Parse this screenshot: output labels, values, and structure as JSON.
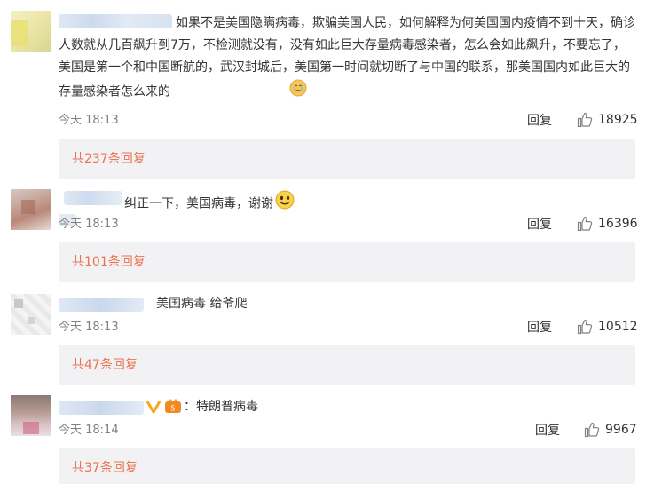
{
  "comments": [
    {
      "text": "如果不是美国隐瞒病毒，欺骗美国人民，如何解释为何美国国内疫情不到十天，确诊人数就从几百飙升到7万，不检测就没有，没有如此巨大存量病毒感染者，怎么会如此飙升，不要忘了，美国是第一个和中国断航的，武汉封城后，美国第一时间就切断了与中国的联系，那美国国内如此巨大的存量感染者怎么来的",
      "time": "今天 18:13",
      "reply": "回复",
      "likes": "18925",
      "sub_replies": "共237条回复"
    },
    {
      "text": "纠正一下，美国病毒，谢谢",
      "time": "今天 18:13",
      "reply": "回复",
      "likes": "16396",
      "sub_replies": "共101条回复"
    },
    {
      "text": "美国病毒 给爷爬",
      "time": "今天 18:13",
      "reply": "回复",
      "likes": "10512",
      "sub_replies": "共47条回复"
    },
    {
      "text": "：特朗普病毒",
      "time": "今天 18:14",
      "reply": "回复",
      "likes": "9967",
      "sub_replies": "共37条回复",
      "badge_color": "#f5a623"
    }
  ],
  "colors": {
    "link": "#eb7350",
    "subbar_bg": "#f2f2f5",
    "meta": "#808080"
  }
}
